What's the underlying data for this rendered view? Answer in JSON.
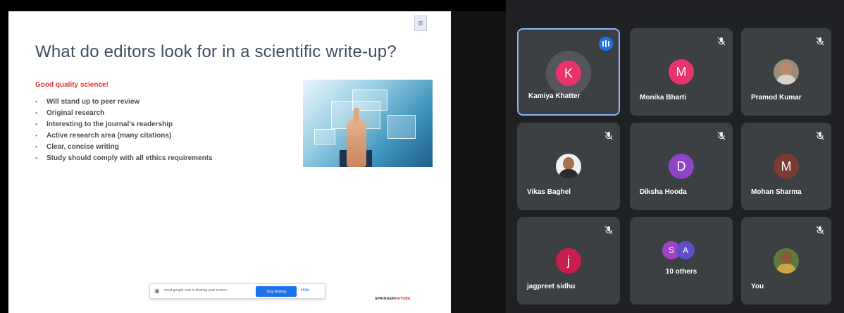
{
  "slide": {
    "title": "What do editors look for in a scientific write-up?",
    "subtitle": "Good quality science!",
    "bullets": [
      "Will stand up to peer review",
      "Original research",
      "Interesting to the journal's readership",
      "Active research area (many citations)",
      "Clear, concise writing",
      "Study should comply with all ethics requirements"
    ],
    "brand_left": "SPRINGER",
    "brand_right": "NATURE"
  },
  "share_bar": {
    "message": "meet.google.com is sharing your screen.",
    "stop_label": "Stop sharing",
    "hide_label": "Hide"
  },
  "participants": [
    {
      "name": "Kamiya Khatter",
      "initial": "K",
      "color": "#e8336d",
      "speaking": true
    },
    {
      "name": "Monika Bharti",
      "initial": "M",
      "color": "#e8336d",
      "muted": true
    },
    {
      "name": "Pramod Kumar",
      "initial": "",
      "photo": true,
      "muted": true
    },
    {
      "name": "Vikas Baghel",
      "initial": "",
      "photo": true,
      "muted": true
    },
    {
      "name": "Diksha Hooda",
      "initial": "D",
      "color": "#8e44c7",
      "muted": true
    },
    {
      "name": "Mohan Sharma",
      "initial": "M",
      "color": "#7a3b32",
      "muted": true
    },
    {
      "name": "jagpreet sidhu",
      "initial": "j",
      "color": "#c81d4f",
      "muted": true
    },
    {
      "name": "10 others",
      "initials": [
        "S",
        "A"
      ],
      "colors": [
        "#a142c4",
        "#5c4fc9"
      ]
    },
    {
      "name": "You",
      "initial": "",
      "photo": true,
      "muted": true
    }
  ],
  "colors": {
    "tile_bg": "#3c4043",
    "active_border": "#8ab4f8",
    "accent": "#1a73e8",
    "slide_title": "#3f4d63",
    "slide_subtitle": "#e0342c"
  }
}
